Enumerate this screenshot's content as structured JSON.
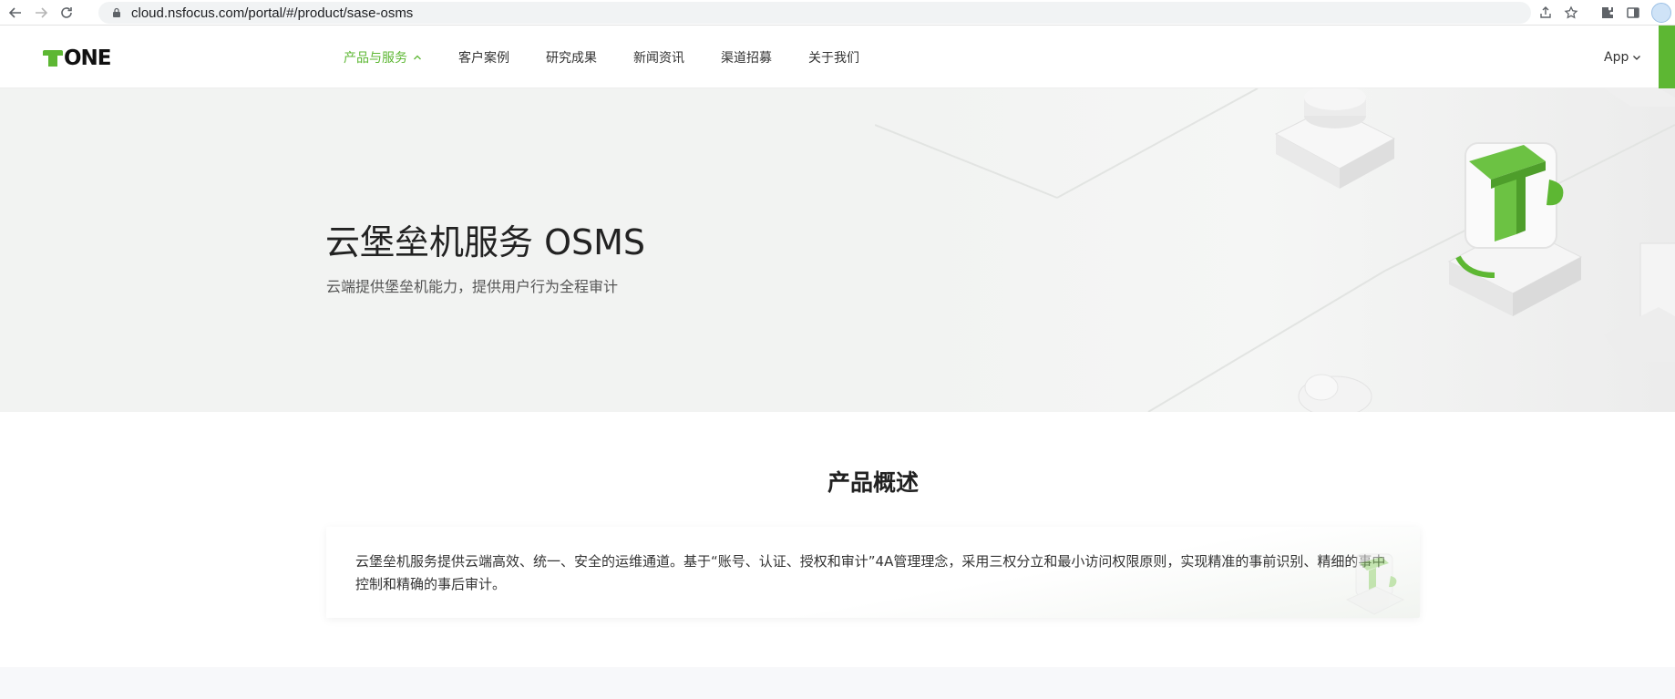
{
  "browser": {
    "url": "cloud.nsfocus.com/portal/#/product/sase-osms"
  },
  "header": {
    "logo_text": "ONE",
    "nav": [
      {
        "label": "产品与服务"
      },
      {
        "label": "客户案例"
      },
      {
        "label": "研究成果"
      },
      {
        "label": "新闻资讯"
      },
      {
        "label": "渠道招募"
      },
      {
        "label": "关于我们"
      }
    ],
    "app_label": "App"
  },
  "hero": {
    "title": "云堡垒机服务 OSMS",
    "subtitle": "云端提供堡垒机能力，提供用户行为全程审计"
  },
  "overview": {
    "title": "产品概述",
    "text": "云堡垒机服务提供云端高效、统一、安全的运维通道。基于“账号、认证、授权和审计”4A管理理念，采用三权分立和最小访问权限原则，实现精准的事前识别、精细的事中控制和精确的事后审计。"
  },
  "colors": {
    "brand_green": "#5db733",
    "text_dark": "#222222",
    "hero_bg": "#f2f3f2"
  }
}
